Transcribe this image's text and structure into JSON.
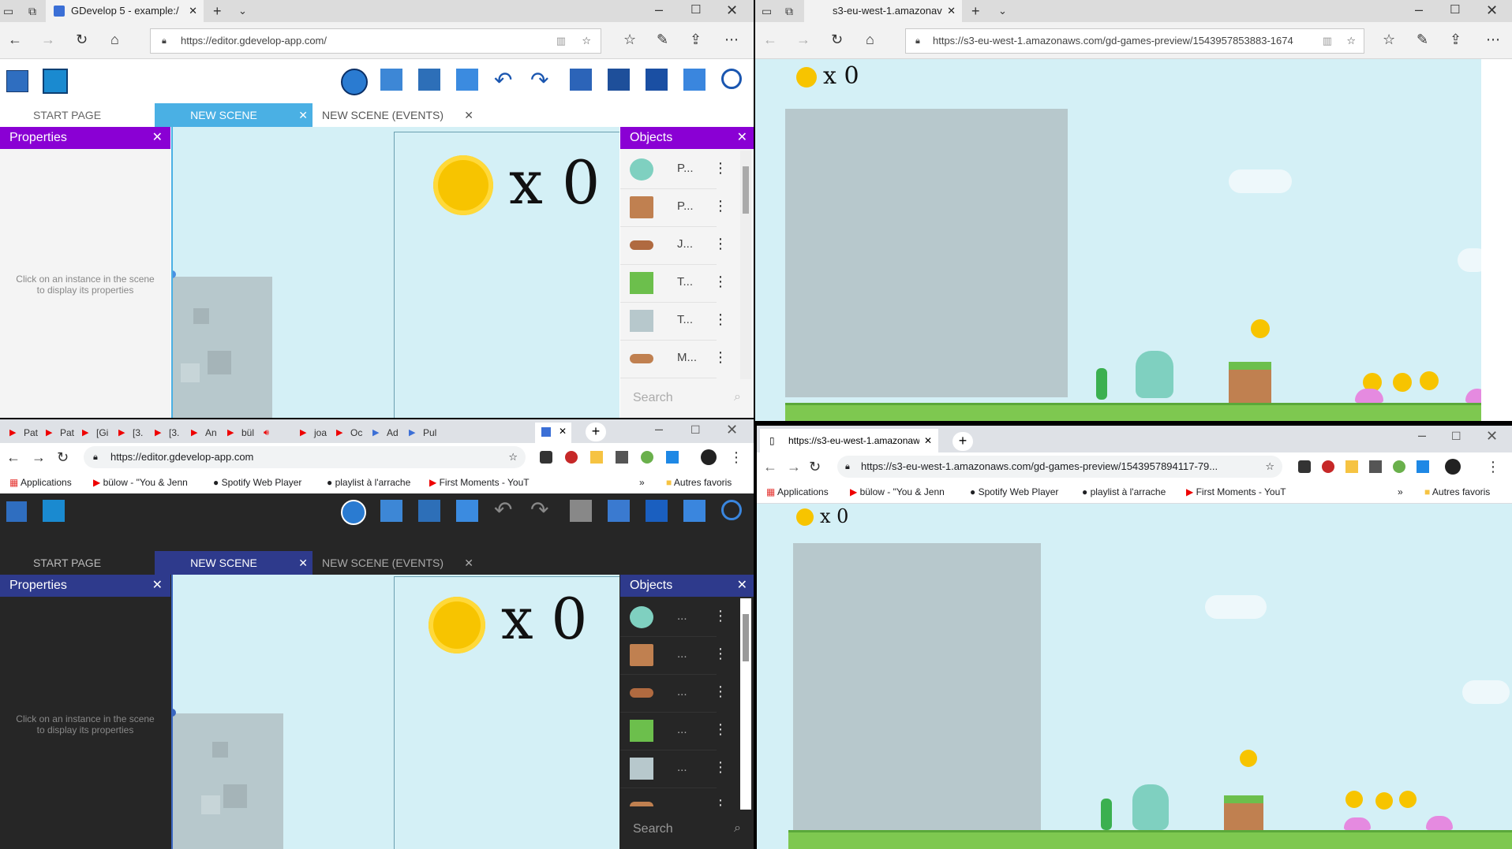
{
  "edge_left": {
    "tab_title": "GDevelop 5 - example:/",
    "url": "https://editor.gdevelop-app.com/"
  },
  "edge_right": {
    "tab_title": "s3-eu-west-1.amazonav",
    "url": "https://s3-eu-west-1.amazonaws.com/gd-games-preview/1543957853883-1674"
  },
  "chrome_left": {
    "mini_tabs": [
      "Pat",
      "Pat",
      "[Gi",
      "[3.",
      "[3.",
      "An",
      "bül",
      "",
      "joa",
      "Oc",
      "Ad",
      "Pul"
    ],
    "url": "https://editor.gdevelop-app.com"
  },
  "chrome_right": {
    "tab_title": "https://s3-eu-west-1.amazonaws",
    "url": "https://s3-eu-west-1.amazonaws.com/gd-games-preview/1543957894117-79..."
  },
  "bookmarks": {
    "applications": "Applications",
    "item1": "bülow - \"You & Jenn",
    "item2": "Spotify Web Player",
    "item3": "playlist à l'arrache",
    "item4": "First Moments - YouT",
    "more": "»",
    "other": "Autres favoris"
  },
  "gdevelop": {
    "tabs": {
      "start": "START PAGE",
      "scene": "NEW SCENE",
      "events": "NEW SCENE (EVENTS)"
    },
    "properties_title": "Properties",
    "properties_hint_1": "Click on an instance in the scene",
    "properties_hint_2": "to display its properties",
    "objects_title": "Objects",
    "objects_light": [
      "P...",
      "P...",
      "J...",
      "T...",
      "T...",
      "M..."
    ],
    "objects_dark": [
      "...",
      "...",
      "...",
      "...",
      "...",
      ""
    ],
    "search_placeholder": "Search"
  },
  "game": {
    "coin_counter": "x 0"
  },
  "colors": {
    "purple": "#8a00d4",
    "blue_dark": "#2e3a8c",
    "tab_blue": "#4ab0e4",
    "sky": "#d4f0f6",
    "grass": "#7ec850"
  }
}
